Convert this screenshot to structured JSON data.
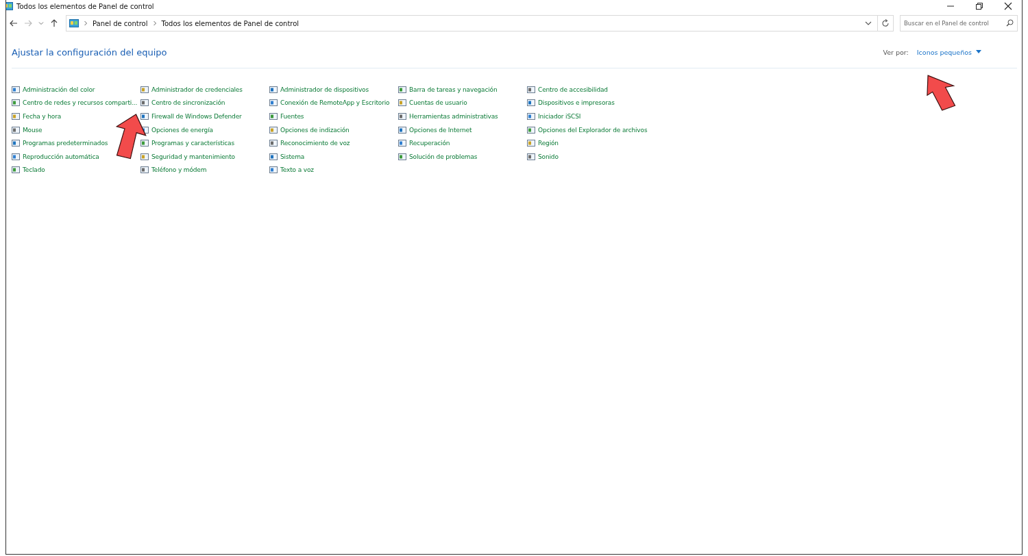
{
  "window": {
    "title": "Todos los elementos de Panel de control"
  },
  "address_bar": {
    "breadcrumbs": [
      "Panel de control",
      "Todos los elementos de Panel de control"
    ]
  },
  "search": {
    "placeholder": "Buscar en el Panel de control"
  },
  "heading": "Ajustar la configuración del equipo",
  "view_by": {
    "label": "Ver por:",
    "value": "Iconos pequeños"
  },
  "columns": [
    [
      "Administración del color",
      "Centro de redes y recursos comparti...",
      "Fecha y hora",
      "Mouse",
      "Programas predeterminados",
      "Reproducción automática",
      "Teclado"
    ],
    [
      "Administrador de credenciales",
      "Centro de sincronización",
      "Firewall de Windows Defender",
      "Opciones de energía",
      "Programas y características",
      "Seguridad y mantenimiento",
      "Teléfono y módem"
    ],
    [
      "Administrador de dispositivos",
      "Conexión de RemoteApp y Escritorio",
      "Fuentes",
      "Opciones de indización",
      "Reconocimiento de voz",
      "Sistema",
      "Texto a voz"
    ],
    [
      "Barra de tareas y navegación",
      "Cuentas de usuario",
      "Herramientas administrativas",
      "Opciones de Internet",
      "Recuperación",
      "Solución de problemas"
    ],
    [
      "Centro de accesibilidad",
      "Dispositivos e impresoras",
      "Iniciador iSCSI",
      "Opciones del Explorador de archivos",
      "Región",
      "Sonido"
    ]
  ]
}
